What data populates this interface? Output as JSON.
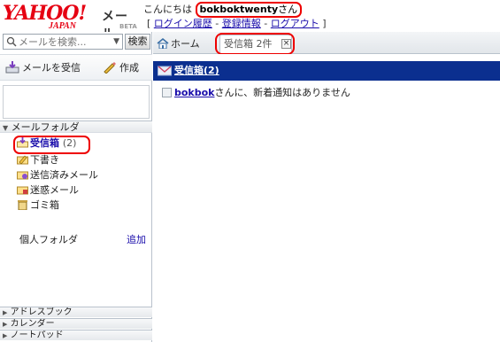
{
  "logo": {
    "brand": "YAHOO!",
    "region": "JAPAN",
    "product": "メール",
    "badge": "BETA"
  },
  "greeting": {
    "prefix": "こんにちは",
    "username": "bokboktwenty",
    "suffix": "さん"
  },
  "header_links": {
    "open": "[",
    "login_history": "ログイン履歴",
    "sep1": "-",
    "registration": "登録情報",
    "sep2": "-",
    "logout": "ログアウト",
    "close": "]"
  },
  "search": {
    "placeholder": "メールを検索...",
    "button": "検索"
  },
  "actions": {
    "receive": "メールを受信",
    "compose": "作成"
  },
  "folders": {
    "header": "メールフォルダ",
    "inbox": {
      "label": "受信箱",
      "count": "(2)"
    },
    "drafts": "下書き",
    "sent": "送信済みメール",
    "spam": "迷惑メール",
    "trash": "ゴミ箱",
    "personal": "個人フォルダ",
    "add": "追加"
  },
  "bottom_sections": {
    "address_book": "アドレスブック",
    "calendar": "カレンダー",
    "notepad": "ノートパッド"
  },
  "tabs": {
    "home": "ホーム",
    "inbox": "受信箱 2件",
    "close": "×"
  },
  "main": {
    "inbox_title": "受信箱(2)",
    "notice_name": "bokbok",
    "notice_text": "さんに、新着通知はありません"
  },
  "colors": {
    "accent_red": "#e60012",
    "header_bar": "#0b2f8f",
    "link": "#1a0dab",
    "highlight_ring": "#ee0000"
  }
}
